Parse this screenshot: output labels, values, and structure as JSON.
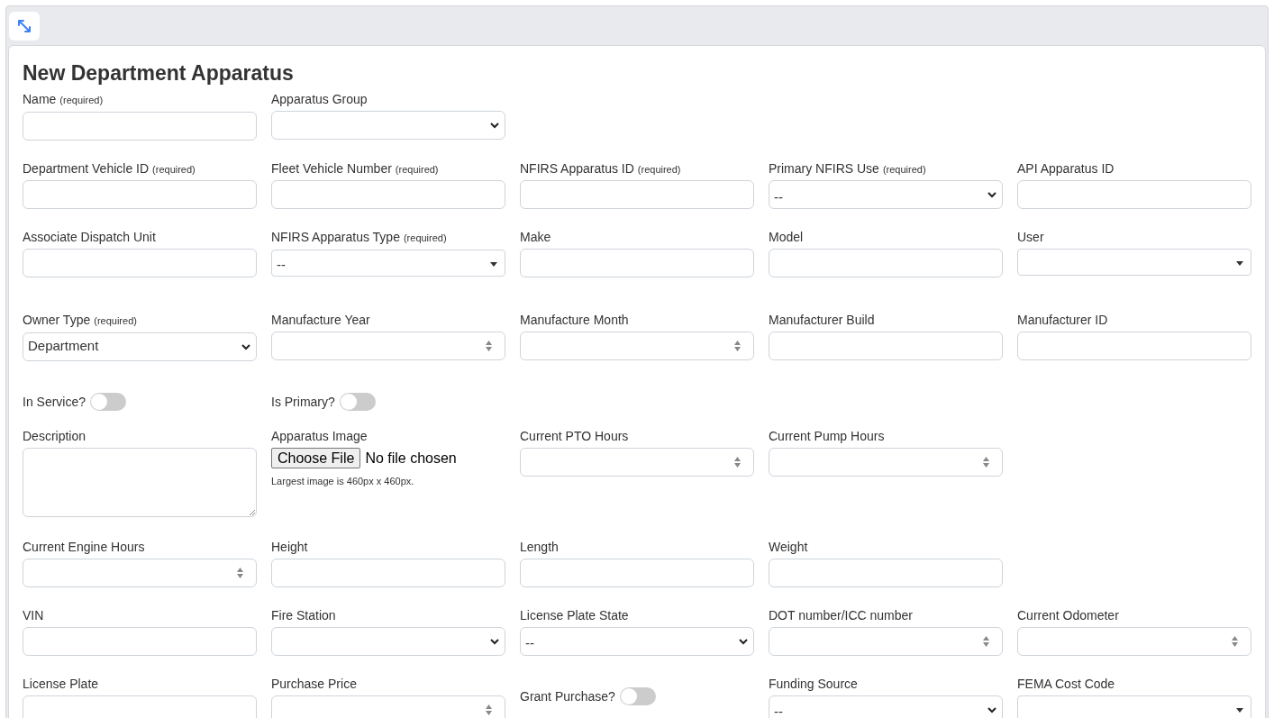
{
  "title": "New Department Apparatus",
  "rows": [
    [
      {
        "kind": "text",
        "label": "Name",
        "note": "(required)"
      },
      {
        "kind": "select",
        "label": "Apparatus Group"
      }
    ],
    [
      {
        "kind": "text",
        "label": "Department Vehicle ID",
        "note": "(required)"
      },
      {
        "kind": "text",
        "label": "Fleet Vehicle Number",
        "note": "(required)"
      },
      {
        "kind": "text",
        "label": "NFIRS Apparatus ID",
        "note": "(required)"
      },
      {
        "kind": "select",
        "label": "Primary NFIRS Use",
        "note": "(required)",
        "value": "--"
      },
      {
        "kind": "text",
        "label": "API Apparatus ID"
      }
    ],
    [
      {
        "kind": "text",
        "label": "Associate Dispatch Unit"
      },
      {
        "kind": "dropdown",
        "label": "NFIRS Apparatus Type",
        "note": "(required)",
        "value": "--"
      },
      {
        "kind": "text",
        "label": "Make"
      },
      {
        "kind": "text",
        "label": "Model"
      },
      {
        "kind": "dropdown",
        "label": "User"
      }
    ],
    [
      {
        "kind": "select",
        "label": "Owner Type",
        "note": "(required)",
        "value": "Department"
      },
      {
        "kind": "number",
        "label": "Manufacture Year"
      },
      {
        "kind": "number",
        "label": "Manufacture Month"
      },
      {
        "kind": "text",
        "label": "Manufacturer Build"
      },
      {
        "kind": "text",
        "label": "Manufacturer ID"
      }
    ],
    [
      {
        "kind": "toggle",
        "label": "In Service?",
        "on": false
      },
      {
        "kind": "toggle",
        "label": "Is Primary?",
        "on": false
      }
    ],
    [
      {
        "kind": "textarea",
        "label": "Description"
      },
      {
        "kind": "file",
        "label": "Apparatus Image",
        "button": "Choose File",
        "status": "No file chosen",
        "help": "Largest image is 460px x 460px."
      },
      {
        "kind": "number",
        "label": "Current PTO Hours"
      },
      {
        "kind": "number",
        "label": "Current Pump Hours"
      }
    ],
    [
      {
        "kind": "number",
        "label": "Current Engine Hours"
      },
      {
        "kind": "text",
        "label": "Height"
      },
      {
        "kind": "text",
        "label": "Length"
      },
      {
        "kind": "text",
        "label": "Weight"
      }
    ],
    [
      {
        "kind": "text",
        "label": "VIN"
      },
      {
        "kind": "select",
        "label": "Fire Station"
      },
      {
        "kind": "select",
        "label": "License Plate State",
        "value": "--"
      },
      {
        "kind": "number",
        "label": "DOT number/ICC number"
      },
      {
        "kind": "number",
        "label": "Current Odometer"
      }
    ],
    [
      {
        "kind": "text",
        "label": "License Plate"
      },
      {
        "kind": "number",
        "label": "Purchase Price"
      },
      {
        "kind": "toggle",
        "label": "Grant Purchase?",
        "on": false
      },
      {
        "kind": "select",
        "label": "Funding Source",
        "value": "--"
      },
      {
        "kind": "dropdown",
        "label": "FEMA Cost Code"
      }
    ]
  ]
}
